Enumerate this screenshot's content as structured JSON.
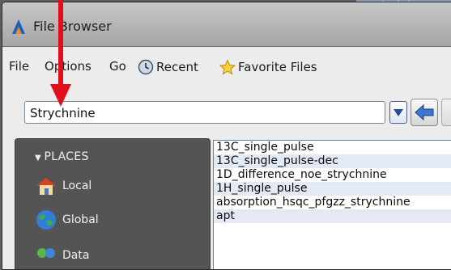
{
  "background_tab": {
    "label": "strychnine"
  },
  "window": {
    "title": "File Browser"
  },
  "menubar": {
    "items": [
      {
        "label": "File"
      },
      {
        "label": "Options"
      },
      {
        "label": "Go"
      },
      {
        "label": "Recent",
        "icon": "clock-icon"
      },
      {
        "label": "Favorite Files",
        "icon": "star-icon"
      }
    ]
  },
  "toolbar": {
    "path_value": "Strychnine",
    "dropdown_icon": "chevron-down-icon",
    "back_icon": "arrow-left-icon"
  },
  "places": {
    "header": "PLACES",
    "items": [
      {
        "label": "Local",
        "icon": "home-icon"
      },
      {
        "label": "Global",
        "icon": "globe-icon"
      },
      {
        "label": "Data",
        "icon": "data-icon"
      }
    ]
  },
  "file_list": {
    "items": [
      "13C_single_pulse",
      "13C_single_pulse-dec",
      "1D_difference_noe_strychnine",
      "1H_single_pulse",
      "absorption_hsqc_pfgzz_strychnine",
      "apt"
    ]
  },
  "colors": {
    "annotation_arrow": "#e0101a",
    "list_border": "#5f7fb0",
    "list_alt_row": "#e3eaf6",
    "places_bg": "#545454"
  }
}
